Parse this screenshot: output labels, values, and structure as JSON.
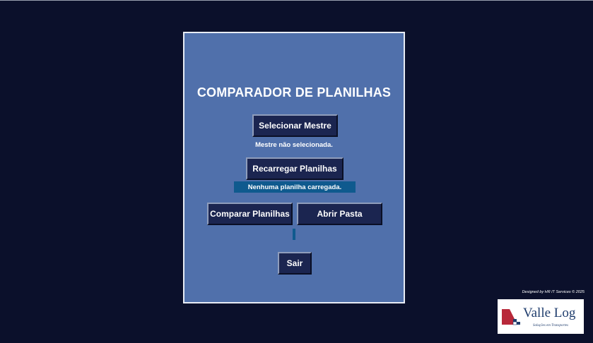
{
  "panel": {
    "title": "COMPARADOR DE PLANILHAS",
    "buttons": {
      "select_master": "Selecionar Mestre",
      "reload": "Recarregar Planilhas",
      "compare": "Comparar Planilhas",
      "open_folder": "Abrir Pasta",
      "exit": "Sair"
    },
    "master_status": "Mestre não selecionada.",
    "sheets_status": "Nenhuma planilha carregada.",
    "progress": 0
  },
  "footer": {
    "credit": "Designed by HR IT Services © 2025",
    "logo": {
      "name": "Valle Log",
      "tagline": "Soluções em Transportes"
    }
  },
  "colors": {
    "background": "#0b102b",
    "panel": "#5070ab",
    "button": "#1b2550",
    "status_bar": "#0f5a8e",
    "logo_red": "#b8283a",
    "logo_blue": "#1f3d6d"
  }
}
